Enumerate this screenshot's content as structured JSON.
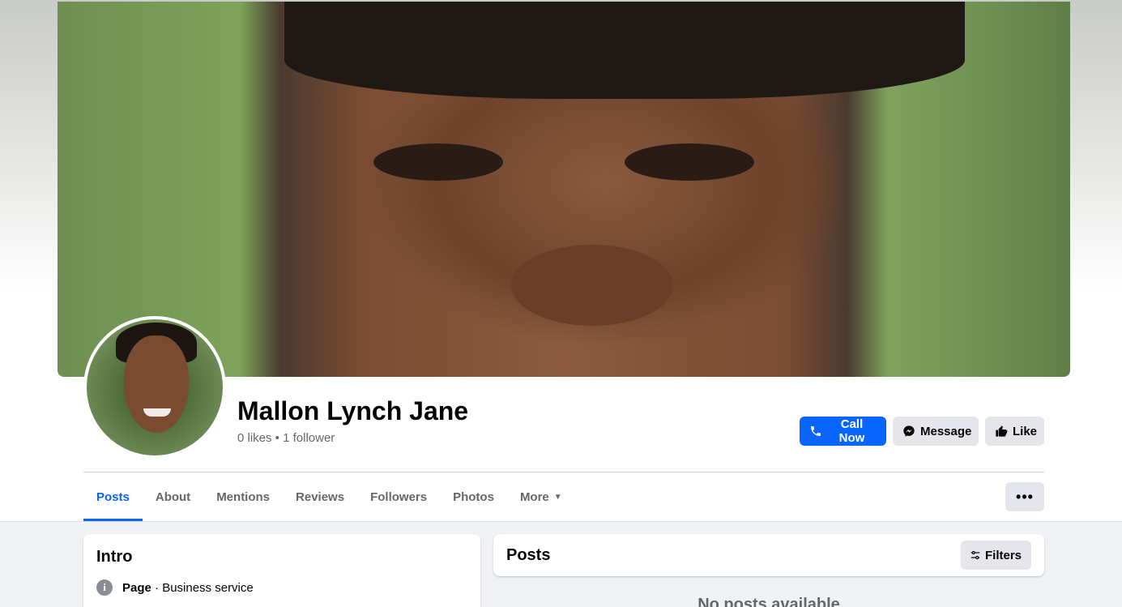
{
  "profile": {
    "name": "Mallon Lynch Jane",
    "stats": "0 likes • 1 follower"
  },
  "actions": {
    "call": "Call Now",
    "message": "Message",
    "like": "Like"
  },
  "tabs": [
    {
      "label": "Posts",
      "active": true
    },
    {
      "label": "About"
    },
    {
      "label": "Mentions"
    },
    {
      "label": "Reviews"
    },
    {
      "label": "Followers"
    },
    {
      "label": "Photos"
    },
    {
      "label": "More"
    }
  ],
  "more_menu": "•••",
  "intro": {
    "title": "Intro",
    "page_label": "Page",
    "page_category": " · Business service"
  },
  "posts": {
    "title": "Posts",
    "filters": "Filters",
    "empty": "No posts available"
  },
  "colors": {
    "accent": "#0866ff",
    "button_gray": "#e4e6eb",
    "background": "#f0f2f5"
  },
  "icons": [
    "phone-icon",
    "messenger-icon",
    "thumbs-up-icon",
    "info-icon",
    "filters-icon",
    "caret-down-icon"
  ]
}
